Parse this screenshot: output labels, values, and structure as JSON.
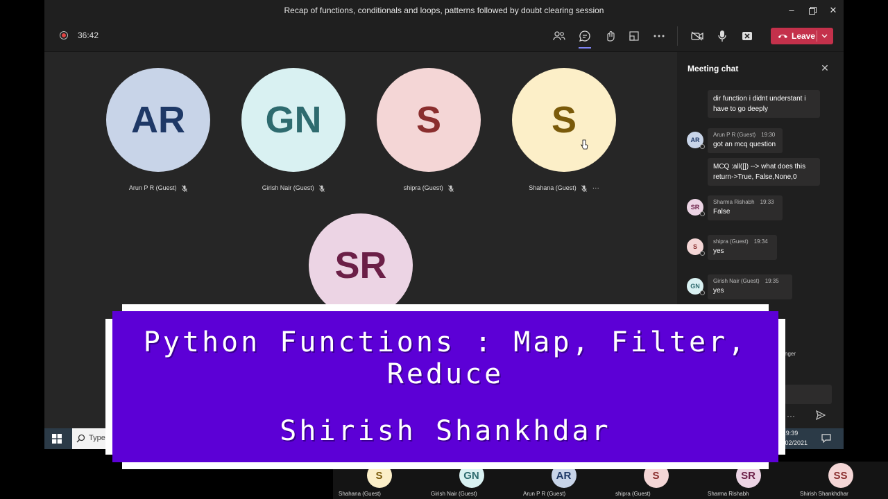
{
  "window": {
    "title": "Recap of functions, conditionals and loops, patterns followed by doubt clearing session",
    "minimize_icon": "minimize-icon",
    "restore_icon": "restore-icon",
    "close_icon": "close-icon"
  },
  "meeting_bar": {
    "timer": "36:42",
    "leave_label": "Leave",
    "leave_color": "#c4314b"
  },
  "participants": [
    {
      "initials": "AR",
      "name": "Arun P R (Guest)",
      "bg": "#c8d4e8",
      "fg": "#1e3866"
    },
    {
      "initials": "GN",
      "name": "Girish Nair (Guest)",
      "bg": "#d9f1f2",
      "fg": "#2e6b6f"
    },
    {
      "initials": "S",
      "name": "shipra (Guest)",
      "bg": "#f4d6d6",
      "fg": "#8a2e2e"
    },
    {
      "initials": "S",
      "name": "Shahana (Guest)",
      "bg": "#fcefc8",
      "fg": "#7a5a0a"
    },
    {
      "initials": "SR",
      "name": "",
      "bg": "#ecd4e4",
      "fg": "#6b1f47"
    }
  ],
  "chat": {
    "title": "Meeting chat",
    "messages": [
      {
        "body": "dir  function i didnt understant i have to go deeply"
      },
      {
        "initials": "AR",
        "sender": "Arun P R (Guest)",
        "time": "19:30",
        "body": "got an mcq question"
      },
      {
        "body": "MCQ :all([]) --> what does this return->True, False,None,0"
      },
      {
        "initials": "SR",
        "sender": "Sharma Rishabh",
        "time": "19:33",
        "body": "False"
      },
      {
        "initials": "S",
        "sender": "shipra (Guest)",
        "time": "19:34",
        "body": "yes"
      },
      {
        "initials": "GN",
        "sender": "Girish Nair (Guest)",
        "time": "19:35",
        "body": "yes"
      }
    ],
    "partial_text": "nger"
  },
  "taskbar": {
    "search_placeholder": "Type",
    "time": "19:39",
    "date": "0/02/2021"
  },
  "strip": [
    {
      "initials": "S",
      "name": "Shahana (Guest)",
      "bg": "#fcefc8",
      "fg": "#7a5a0a"
    },
    {
      "initials": "GN",
      "name": "Girish Nair (Guest)",
      "bg": "#d9f1f2",
      "fg": "#2e6b6f"
    },
    {
      "initials": "AR",
      "name": "Arun P R (Guest)",
      "bg": "#c8d4e8",
      "fg": "#1e3866"
    },
    {
      "initials": "S",
      "name": "shipra (Guest)",
      "bg": "#f4d6d6",
      "fg": "#8a2e2e"
    },
    {
      "initials": "SR",
      "name": "Sharma Rishabh",
      "bg": "#ecd4e4",
      "fg": "#6b1f47"
    },
    {
      "initials": "SS",
      "name": "Shirish Shankhdhar",
      "bg": "#f4d6d6",
      "fg": "#8a2e2e"
    }
  ],
  "banner": {
    "title": "Python Functions : Map, Filter, Reduce",
    "author": "Shirish Shankhdar",
    "bg_color": "#5c00d6"
  }
}
